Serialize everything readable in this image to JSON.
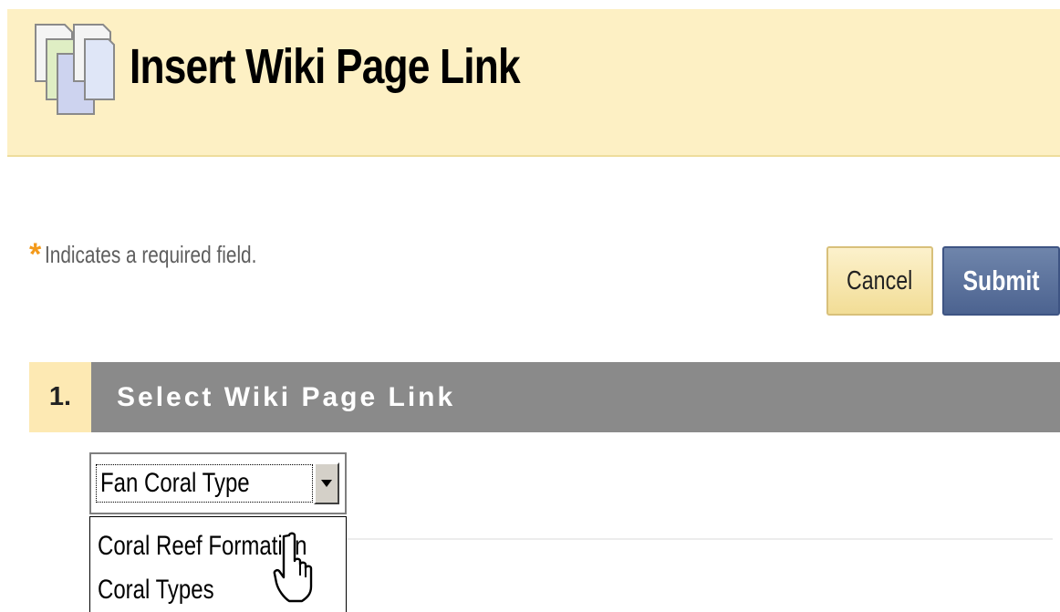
{
  "header": {
    "title": "Insert Wiki Page Link",
    "icon": "wiki-pages-icon",
    "background_color": "#fdf0c4"
  },
  "required_note": {
    "marker": "*",
    "text": "Indicates a required field.",
    "marker_color": "#f39a1b"
  },
  "actions": {
    "cancel_label": "Cancel",
    "submit_label": "Submit",
    "submit_color": "#4c6390"
  },
  "step": {
    "number": "1.",
    "title": "Select Wiki Page Link",
    "bar_color": "#8a8a8a"
  },
  "wiki_page_select": {
    "selected": "Fan Coral Type",
    "options": [
      "Coral Reef Formation",
      "Coral Types"
    ],
    "expanded": true
  },
  "cursor": {
    "icon": "hand-pointer-cursor-icon"
  }
}
